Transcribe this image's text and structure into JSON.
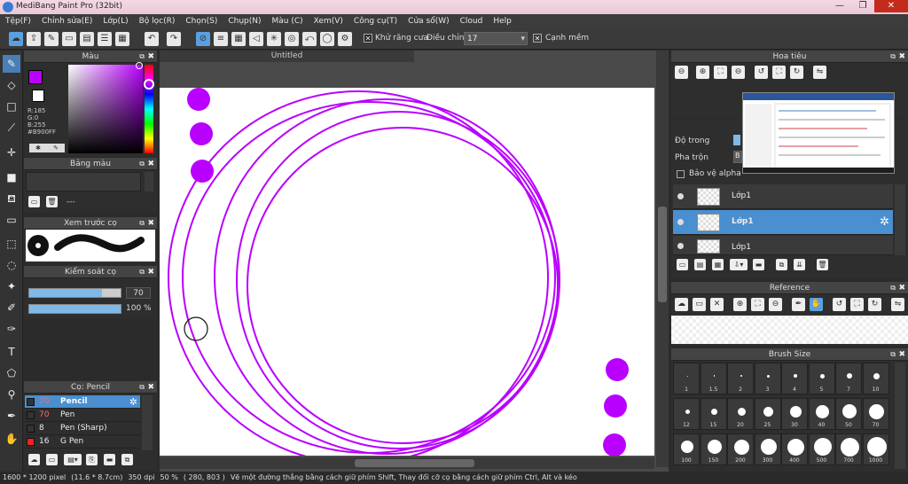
{
  "app": {
    "title": "MediBang Paint Pro (32bit)",
    "minimize": "—",
    "maximize": "❐",
    "close": "✕"
  },
  "menu": [
    "Tệp(F)",
    "Chỉnh sửa(E)",
    "Lớp(L)",
    "Bộ lọc(R)",
    "Chọn(S)",
    "Chụp(N)",
    "Màu (C)",
    "Xem(V)",
    "Công cụ(T)",
    "Cửa sổ(W)",
    "Cloud",
    "Help"
  ],
  "toolbar": {
    "antialias_check": "✕",
    "antialias_label": "Khử răng cưa",
    "correction_label": "Điều chỉnh",
    "correction_value": "17",
    "smooth_check": "✕",
    "smooth_label": "Cạnh mềm"
  },
  "color_panel": {
    "title": "Màu",
    "fg_color": "#b900ff",
    "r": "R:185",
    "g": "G:0",
    "b": "B:255",
    "hex": "#B900FF"
  },
  "palette_panel": {
    "title": "Bảng màu",
    "name": "---"
  },
  "brush_preview": {
    "title": "Xem trước cọ"
  },
  "brush_control": {
    "title": "Kiểm soát cọ",
    "size_value": "70",
    "size_fill": 0.8,
    "opacity_value": "100 %",
    "opacity_fill": 1.0
  },
  "brush_list": {
    "title": "Cọ: Pencil",
    "items": [
      {
        "num": "70",
        "name": "Pencil",
        "color": "#333333",
        "selected": true
      },
      {
        "num": "70",
        "name": "Pen",
        "color": "#333333",
        "selected": false
      },
      {
        "num": "8",
        "name": "Pen (Sharp)",
        "color": "#333333",
        "selected": false
      },
      {
        "num": "16",
        "name": "G Pen",
        "color": "#ff2020",
        "selected": false
      }
    ]
  },
  "canvas": {
    "tab": "Untitled"
  },
  "status": {
    "size": "1600 * 1200 pixel",
    "cm": "(11.6 * 8.7cm)",
    "dpi": "350 dpi",
    "zoom": "50 %",
    "coords": "( 280, 803 )",
    "hint": "Vẽ một đường thẳng bằng cách giữ phím Shift, Thay đổi cỡ cọ bằng cách giữ phím Ctrl, Alt và kéo"
  },
  "navigator": {
    "title": "Hoa tiêu"
  },
  "layers": {
    "opacity_label": "Độ trong",
    "blend_label": "Pha trộn",
    "blend_value": "B",
    "protect_alpha": "Bảo vệ alpha",
    "items": [
      {
        "name": "Lớp1",
        "selected": false
      },
      {
        "name": "Lớp1",
        "selected": true
      },
      {
        "name": "Lớp1",
        "selected": false
      }
    ]
  },
  "reference": {
    "title": "Reference"
  },
  "brush_size": {
    "title": "Brush Size",
    "sizes": [
      "1",
      "1.5",
      "2",
      "3",
      "4",
      "5",
      "7",
      "10",
      "12",
      "15",
      "20",
      "25",
      "30",
      "40",
      "50",
      "70",
      "100",
      "150",
      "200",
      "300",
      "400",
      "500",
      "700",
      "1000"
    ]
  }
}
